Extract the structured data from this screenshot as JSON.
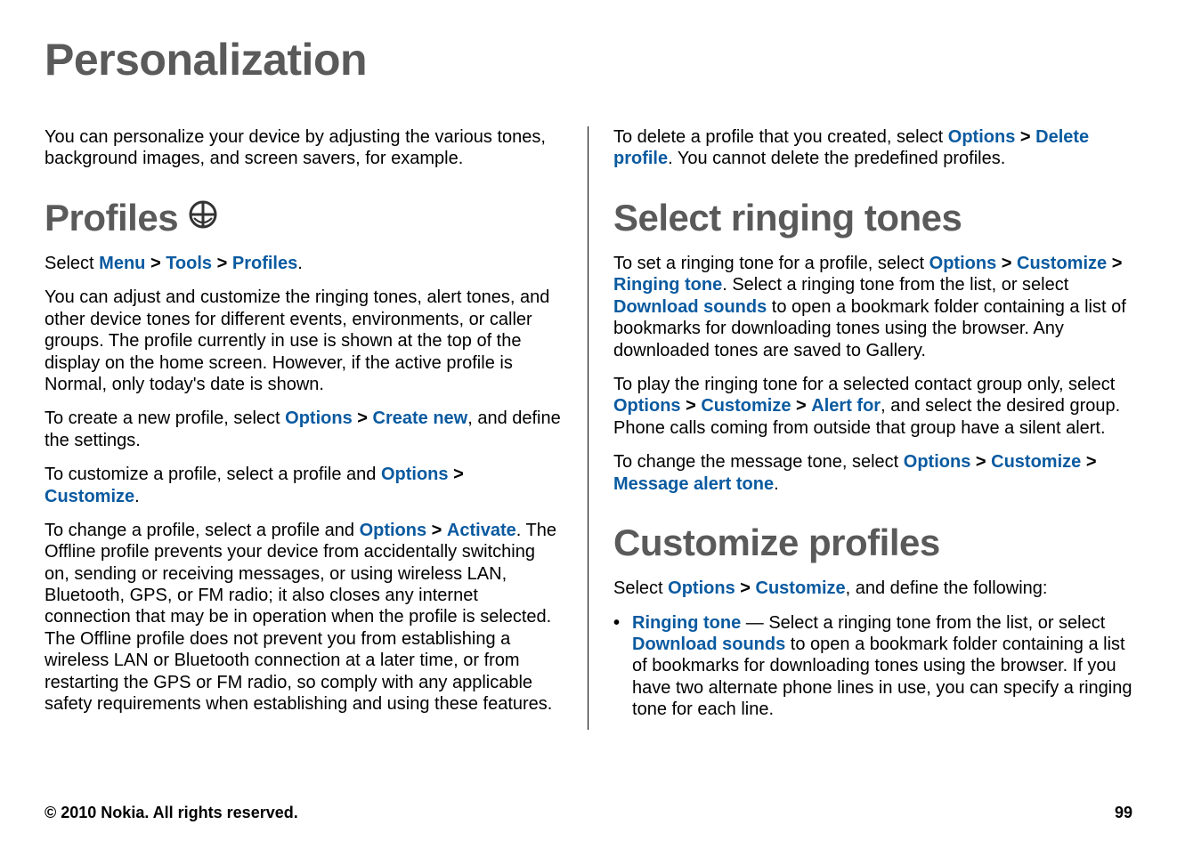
{
  "title": "Personalization",
  "intro": "You can personalize your device by adjusting the various tones, background images, and screen savers, for example.",
  "profiles": {
    "heading": "Profiles",
    "nav": {
      "select": "Select ",
      "menu": "Menu",
      "tools": "Tools",
      "profiles": "Profiles",
      "end": "."
    },
    "para1": "You can adjust and customize the ringing tones, alert tones, and other device tones for different events, environments, or caller groups. The profile currently in use is shown at the top of the display on the home screen. However, if the active profile is Normal, only today's date is shown.",
    "create": {
      "pre": "To create a new profile, select ",
      "options": "Options",
      "createNew": "Create new",
      "post": ", and define the settings."
    },
    "customize": {
      "pre": "To customize a profile, select a profile and ",
      "options": "Options",
      "customize": "Customize",
      "post": "."
    },
    "activate": {
      "pre": "To change a profile, select a profile and ",
      "options": "Options",
      "activate": "Activate",
      "post": ". The Offline profile prevents your device from accidentally switching on, sending or receiving messages, or using wireless LAN, Bluetooth, GPS, or FM radio; it also closes any internet connection that may be in operation when the profile is selected. The Offline profile does not prevent you from establishing a wireless LAN or Bluetooth connection at a later time, or from restarting the GPS or FM radio, so comply with any applicable safety requirements when establishing and using these features."
    }
  },
  "rightTop": {
    "pre": "To delete a profile that you created, select ",
    "options": "Options",
    "deleteProfile": "Delete profile",
    "post": ". You cannot delete the predefined profiles."
  },
  "ringing": {
    "heading": "Select ringing tones",
    "p1": {
      "pre": "To set a ringing tone for a profile, select ",
      "options": "Options",
      "customize": "Customize",
      "ringingTone": "Ringing tone",
      "mid": ". Select a ringing tone from the list, or select ",
      "download": "Download sounds",
      "post": " to open a bookmark folder containing a list of bookmarks for downloading tones using the browser. Any downloaded tones are saved to Gallery."
    },
    "p2": {
      "pre": "To play the ringing tone for a selected contact group only, select ",
      "options": "Options",
      "customize": "Customize",
      "alertFor": "Alert for",
      "post": ", and select the desired group. Phone calls coming from outside that group have a silent alert."
    },
    "p3": {
      "pre": "To change the message tone, select ",
      "options": "Options",
      "customize": "Customize",
      "msgTone": "Message alert tone",
      "post": "."
    }
  },
  "custom": {
    "heading": "Customize profiles",
    "lead": {
      "pre": "Select ",
      "options": "Options",
      "customize": "Customize",
      "post": ", and define the following:"
    },
    "bullet": {
      "ringingTone": "Ringing tone",
      "pre": " — Select a ringing tone from the list, or select ",
      "download": "Download sounds",
      "post": " to open a bookmark folder containing a list of bookmarks for downloading tones using the browser. If you have two alternate phone lines in use, you can specify a ringing tone for each line."
    }
  },
  "footer": {
    "copyright": "© 2010 Nokia. All rights reserved.",
    "page": "99"
  },
  "gt": ">"
}
